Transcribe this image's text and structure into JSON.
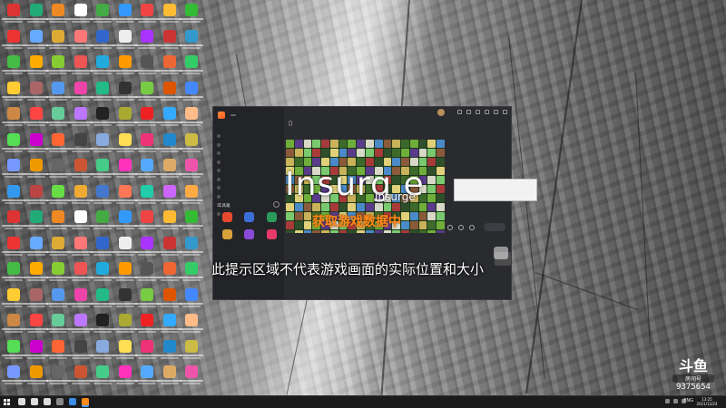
{
  "desktop": {
    "icon_colors": [
      "#d33",
      "#2a7",
      "#e82",
      "#fff",
      "#4a4",
      "#39f",
      "#e44",
      "#fb3",
      "#3b3",
      "#e33",
      "#6af",
      "#da3",
      "#f77",
      "#36c",
      "#eee",
      "#a3f",
      "#c33",
      "#39c",
      "#4b4",
      "#fa0",
      "#8c3",
      "#e55",
      "#2ad",
      "#f90",
      "#555",
      "#e63",
      "#3c6",
      "#fc3",
      "#a66",
      "#59e",
      "#e4a",
      "#2b8",
      "#333",
      "#7c4",
      "#d50",
      "#48f",
      "#c84",
      "#f44",
      "#6c9",
      "#b7f",
      "#222",
      "#aa3",
      "#e22",
      "#3af",
      "#fb8",
      "#5d5",
      "#c0c",
      "#f63",
      "#444",
      "#8ad",
      "#fd5",
      "#e37",
      "#28c",
      "#cb4",
      "#79f",
      "#e90",
      "#666",
      "#c53",
      "#4c8",
      "#f3b",
      "#5af",
      "#da6",
      "#e5a",
      "#39e",
      "#b44",
      "#6d4",
      "#ea3",
      "#47c",
      "#f75",
      "#2ca",
      "#c6f",
      "#fa4"
    ]
  },
  "launcher": {
    "brand": "",
    "brand_badge": "",
    "side_tabs": [
      "",
      ""
    ],
    "side_rows": [
      "",
      "",
      "",
      "",
      "",
      "",
      "",
      "",
      "",
      ""
    ],
    "tools_title": "工具箱",
    "tools": [
      {
        "label": "",
        "color": "#e64a2e"
      },
      {
        "label": "",
        "color": "#3a6fd8"
      },
      {
        "label": "",
        "color": "#2a9a5a"
      },
      {
        "label": "",
        "color": "#d8a23a"
      },
      {
        "label": "",
        "color": "#8a4ad8"
      },
      {
        "label": "",
        "color": "#e63a6a"
      }
    ],
    "side_bottom": [
      "",
      "",
      "",
      ""
    ],
    "game_title": "",
    "game_tag": "",
    "game_meta": [
      "",
      "",
      "",
      ""
    ],
    "bottom_nav": [
      "",
      "",
      "",
      "",
      "",
      "",
      "",
      "",
      "",
      ""
    ]
  },
  "overlay": {
    "game_name": "Insurg e",
    "game_name_small": "Insurge",
    "toast_lines": [
      "",
      "",
      ""
    ],
    "fetching": "获取游戏数据中",
    "caption": "此提示区域不代表游戏画面的实际位置和大小",
    "bubble": ""
  },
  "watermark": {
    "logo": "斗鱼",
    "sub": "房间号",
    "room_id": "9375654"
  },
  "taskbar": {
    "language": "ENG",
    "time": "13:25",
    "date": "2021/12/24",
    "app_colors": [
      "#ffffff",
      "#ffffff",
      "#ffffff",
      "#888888",
      "#3a8ee6",
      "#ff8a1a"
    ]
  }
}
